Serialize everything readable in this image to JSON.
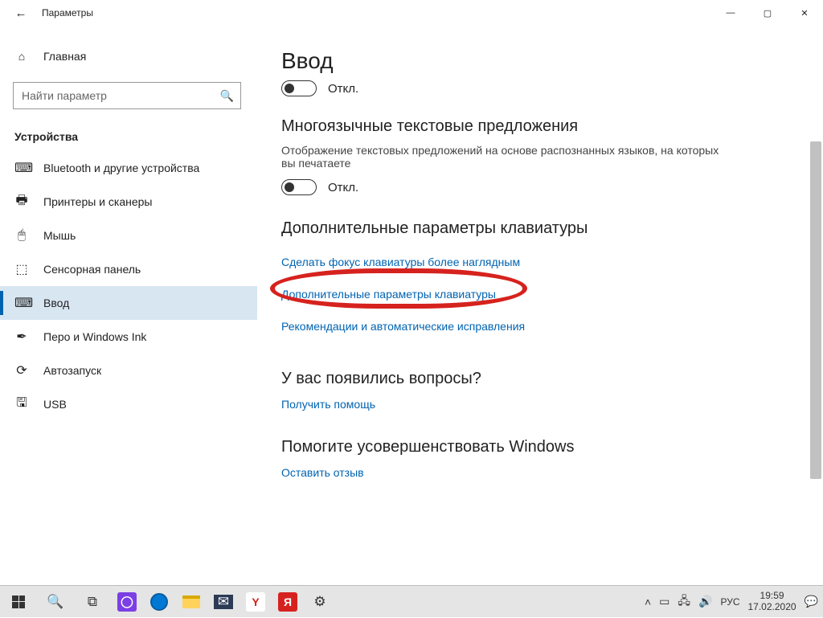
{
  "window": {
    "title": "Параметры",
    "buttons": {
      "min": "—",
      "max": "▢",
      "close": "✕"
    }
  },
  "sidebar": {
    "home_label": "Главная",
    "search_placeholder": "Найти параметр",
    "section": "Устройства",
    "items": [
      {
        "icon": "⌨",
        "label": "Bluetooth и другие устройства"
      },
      {
        "icon": "🖶",
        "label": "Принтеры и сканеры"
      },
      {
        "icon": "🖱",
        "label": "Мышь"
      },
      {
        "icon": "⬚",
        "label": "Сенсорная панель"
      },
      {
        "icon": "⌨",
        "label": "Ввод"
      },
      {
        "icon": "✒",
        "label": "Перо и Windows Ink"
      },
      {
        "icon": "⟳",
        "label": "Автозапуск"
      },
      {
        "icon": "🖫",
        "label": "USB"
      }
    ],
    "active_index": 4
  },
  "content": {
    "page_title": "Ввод",
    "toggle1": {
      "state": "off",
      "label": "Откл."
    },
    "section1": {
      "heading": "Многоязычные текстовые предложения",
      "desc": "Отображение текстовых предложений на основе распознанных языков, на которых вы печатаете",
      "toggle": {
        "state": "off",
        "label": "Откл."
      }
    },
    "section2": {
      "heading": "Дополнительные параметры клавиатуры",
      "links": [
        "Сделать фокус клавиатуры более наглядным",
        "Дополнительные параметры клавиатуры",
        "Рекомендации и автоматические исправления"
      ]
    },
    "section3": {
      "heading": "У вас появились вопросы?",
      "link": "Получить помощь"
    },
    "section4": {
      "heading": "Помогите усовершенствовать Windows",
      "link": "Оставить отзыв"
    }
  },
  "taskbar": {
    "tray": {
      "lang": "РУС",
      "time": "19:59",
      "date": "17.02.2020"
    }
  },
  "annotation": {
    "circled_link_index": 1
  }
}
